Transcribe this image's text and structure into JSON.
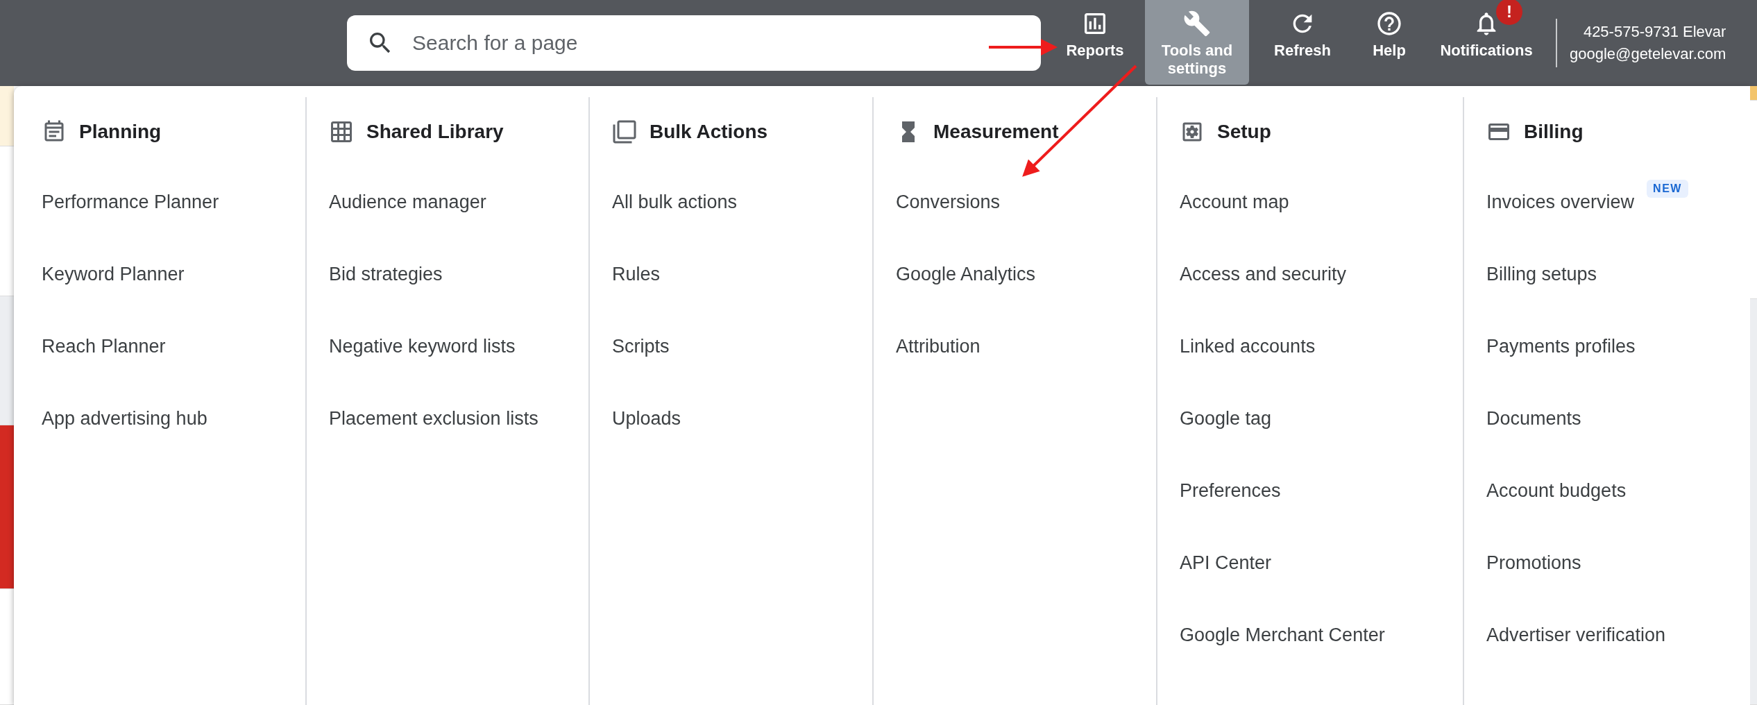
{
  "top_bar": {
    "search": {
      "placeholder": "Search for a page"
    },
    "nav": [
      {
        "label": "Reports",
        "selected": false
      },
      {
        "label": "Tools and settings",
        "selected": true
      },
      {
        "label": "Refresh",
        "selected": false
      },
      {
        "label": "Help",
        "selected": false
      },
      {
        "label": "Notifications",
        "selected": false,
        "badge": "!"
      }
    ],
    "account": {
      "line_1": "425-575-9731 Elevar",
      "line_2": "google@getelevar.com"
    }
  },
  "menu": {
    "columns": [
      {
        "title": "Planning",
        "items": [
          {
            "label": "Performance Planner"
          },
          {
            "label": "Keyword Planner"
          },
          {
            "label": "Reach Planner"
          },
          {
            "label": "App advertising hub"
          }
        ]
      },
      {
        "title": "Shared Library",
        "items": [
          {
            "label": "Audience manager"
          },
          {
            "label": "Bid strategies"
          },
          {
            "label": "Negative keyword lists"
          },
          {
            "label": "Placement exclusion lists"
          }
        ]
      },
      {
        "title": "Bulk Actions",
        "items": [
          {
            "label": "All bulk actions"
          },
          {
            "label": "Rules"
          },
          {
            "label": "Scripts"
          },
          {
            "label": "Uploads"
          }
        ]
      },
      {
        "title": "Measurement",
        "items": [
          {
            "label": "Conversions"
          },
          {
            "label": "Google Analytics"
          },
          {
            "label": "Attribution"
          }
        ]
      },
      {
        "title": "Setup",
        "items": [
          {
            "label": "Account map"
          },
          {
            "label": "Access and security"
          },
          {
            "label": "Linked accounts"
          },
          {
            "label": "Google tag"
          },
          {
            "label": "Preferences"
          },
          {
            "label": "API Center"
          },
          {
            "label": "Google Merchant Center"
          }
        ]
      },
      {
        "title": "Billing",
        "items": [
          {
            "label": "Invoices overview",
            "badge": "NEW"
          },
          {
            "label": "Billing setups"
          },
          {
            "label": "Payments profiles"
          },
          {
            "label": "Documents"
          },
          {
            "label": "Account budgets"
          },
          {
            "label": "Promotions"
          },
          {
            "label": "Advertiser verification"
          }
        ]
      }
    ]
  }
}
